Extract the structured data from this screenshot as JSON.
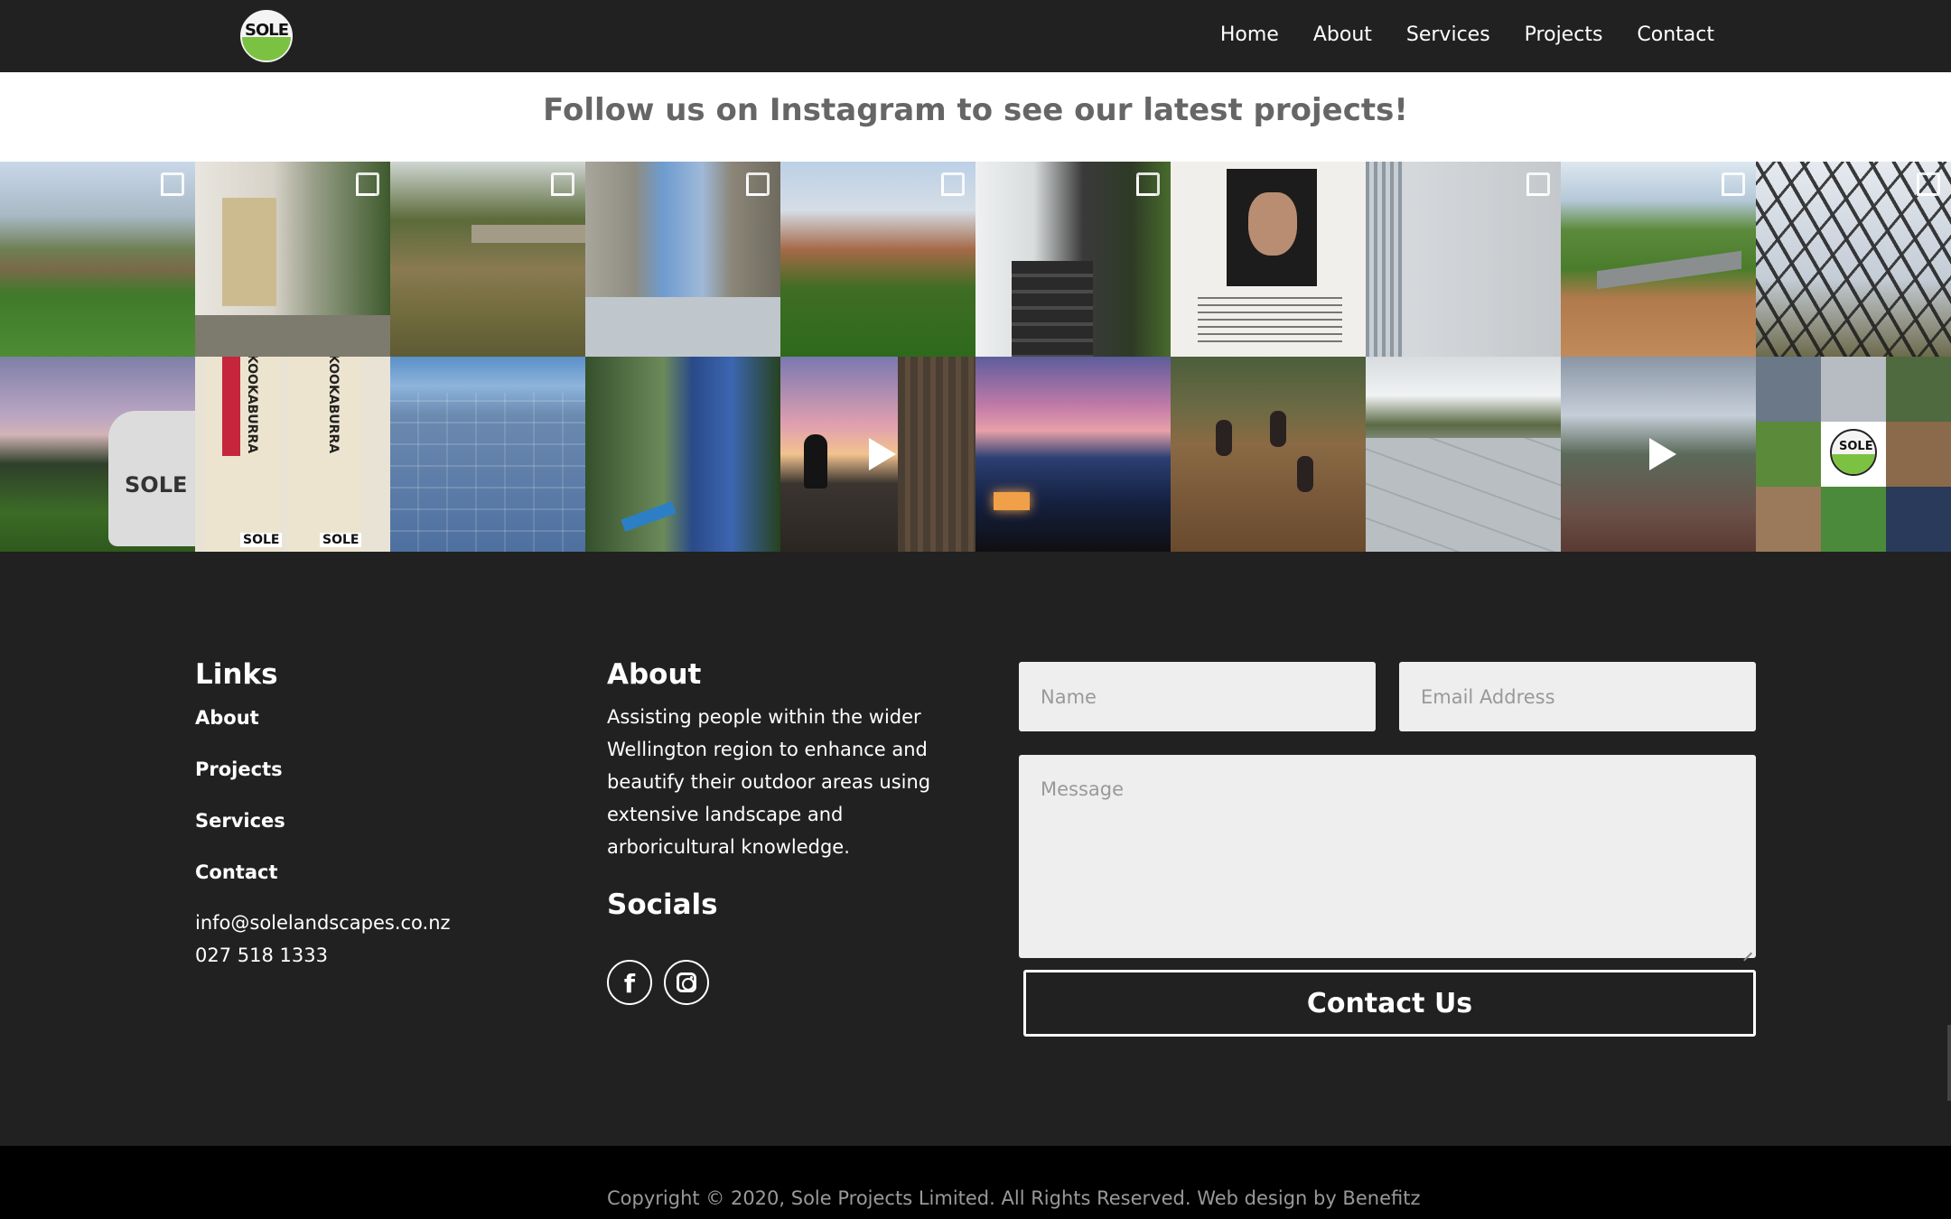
{
  "header": {
    "logo_text": "SOLE",
    "nav": [
      "Home",
      "About",
      "Services",
      "Projects",
      "Contact"
    ]
  },
  "instagram": {
    "heading": "Follow us on Instagram to see our latest projects!",
    "tiles_row1": [
      {
        "name": "garden-lawn",
        "icon": "multi-image-icon"
      },
      {
        "name": "house-porch",
        "icon": "multi-image-icon"
      },
      {
        "name": "dirt-yard-deck",
        "icon": "multi-image-icon"
      },
      {
        "name": "wooden-fence",
        "icon": "multi-image-icon"
      },
      {
        "name": "villa-front-garden",
        "icon": "multi-image-icon"
      },
      {
        "name": "front-steps-gate",
        "icon": "multi-image-icon"
      },
      {
        "name": "portrait-article",
        "icon": ""
      },
      {
        "name": "grey-wall",
        "icon": "multi-image-icon"
      },
      {
        "name": "deck-table",
        "icon": "multi-image-icon"
      },
      {
        "name": "bare-tree",
        "icon": "multi-image-icon"
      }
    ],
    "tiles_row2": [
      {
        "name": "van-sunset",
        "icon": ""
      },
      {
        "name": "cricket-bats",
        "icon": ""
      },
      {
        "name": "wet-pavers",
        "icon": ""
      },
      {
        "name": "bush-view",
        "icon": ""
      },
      {
        "name": "sunset-worker",
        "icon": "play-icon"
      },
      {
        "name": "pink-sky-night",
        "icon": ""
      },
      {
        "name": "team-digging",
        "icon": ""
      },
      {
        "name": "paved-courtyard",
        "icon": ""
      },
      {
        "name": "rooftop-view",
        "icon": "play-icon"
      },
      {
        "name": "collage-team",
        "icon": ""
      }
    ],
    "tile_labels": {
      "van": "SOLE",
      "bat1": "KOOKABURRA",
      "bat2": "KOOKABURRA",
      "bat_sole1": "SOLE",
      "bat_sole2": "SOLE",
      "collage_logo": "SOLE"
    }
  },
  "footer": {
    "links": {
      "title": "Links",
      "items": [
        "About",
        "Projects",
        "Services",
        "Contact"
      ],
      "email": "info@solelandscapes.co.nz",
      "phone": "027 518 1333"
    },
    "about": {
      "title": "About",
      "text": "Assisting people within the wider Wellington region to enhance and beautify their outdoor areas using extensive landscape and arboricultural knowledge."
    },
    "socials": {
      "title": "Socials",
      "facebook_glyph": "f"
    },
    "form": {
      "name_placeholder": "Name",
      "email_placeholder": "Email Address",
      "message_placeholder": "Message",
      "submit_label": "Contact Us"
    },
    "copyright": "Copyright © 2020, Sole Projects Limited. All Rights Reserved. Web design by Benefitz"
  },
  "colors": {
    "background": "#212121",
    "bottom_bar": "#000000",
    "banner_text": "#666666",
    "field_bg": "#eeeeee",
    "logo_green": "#7cc242"
  }
}
